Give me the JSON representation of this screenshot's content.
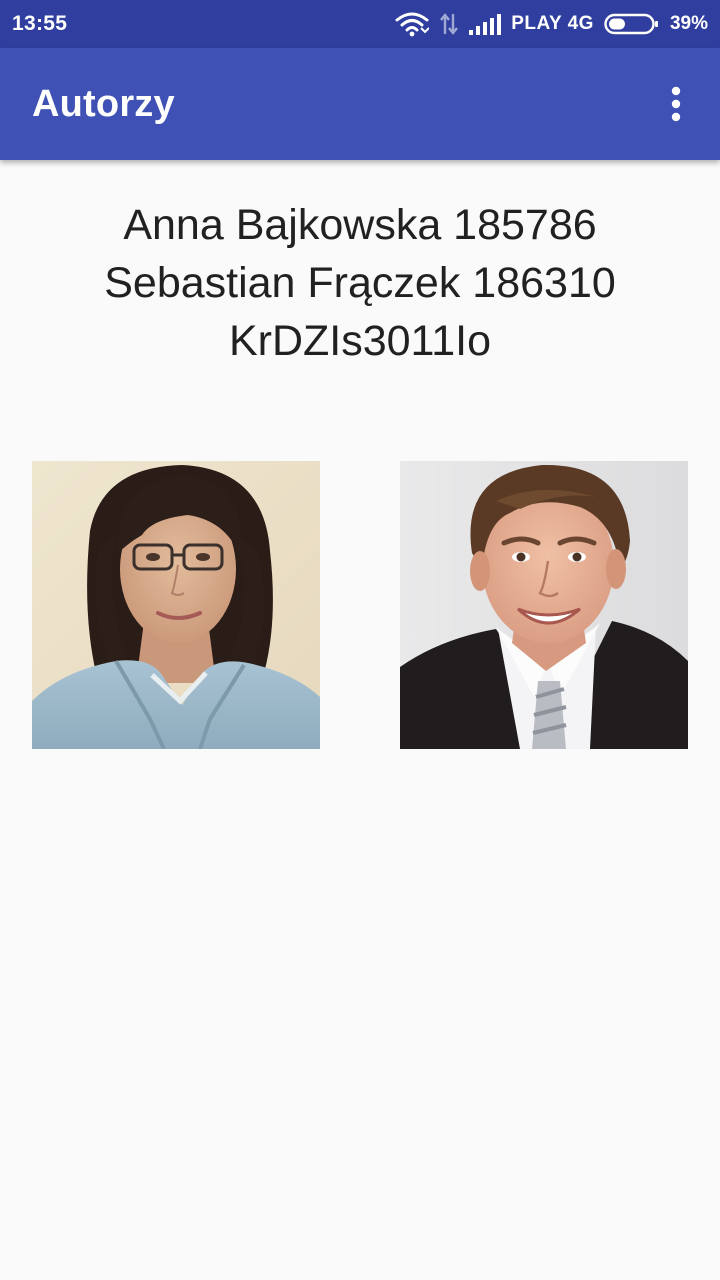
{
  "status_bar": {
    "time": "13:55",
    "carrier": "PLAY 4G",
    "battery_percent": "39%",
    "battery_level": 0.39,
    "icons": [
      "wifi-icon",
      "data-arrows-icon",
      "signal-icon",
      "battery-icon"
    ]
  },
  "app_bar": {
    "title": "Autorzy",
    "menu_icon": "overflow-menu-icon"
  },
  "authors": {
    "line1": "Anna Bajkowska 185786",
    "line2": "Sebastian Frączek 186310",
    "line3": "KrDZIs3011Io"
  },
  "colors": {
    "status_bar": "#303f9f",
    "app_bar": "#3f51b5",
    "background": "#fafafa",
    "text": "#212121"
  }
}
